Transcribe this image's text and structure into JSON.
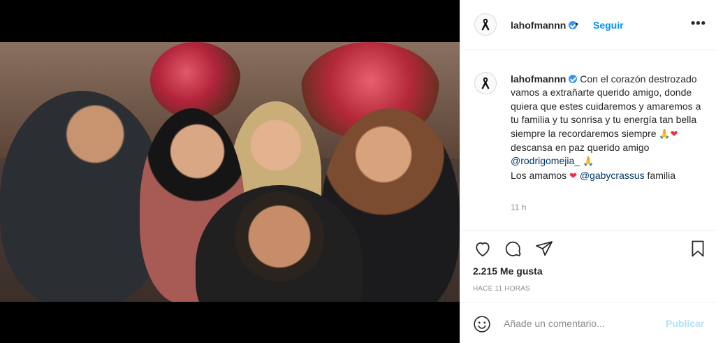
{
  "post": {
    "username": "lahofmannn",
    "follow_label": "Seguir",
    "separator": "•",
    "more_label": "•••"
  },
  "caption": {
    "username": "lahofmannn",
    "line1": "Con el corazón destrozado vamos a extrañarte querido amigo, donde quiera que estes cuidaremos y amaremos a tu familia y tu sonrisa y tu energía tan bella siempre la recordaremos siempre ",
    "emoji_pray": "🙏",
    "emoji_heart": "❤",
    "line2": "descansa en paz querido amigo ",
    "mention1": "@rodrigomejia_",
    "line3": "Los amamos ",
    "mention2": "@gabycrassus",
    "line4": " familia",
    "time": "11 h"
  },
  "actions": {
    "like_icon": "heart-outline-icon",
    "comment_icon": "comment-bubble-icon",
    "share_icon": "paper-plane-icon",
    "save_icon": "bookmark-icon"
  },
  "likes": "2.215 Me gusta",
  "posted_ago": "HACE 11 HORAS",
  "comment_box": {
    "placeholder": "Añade un comentario...",
    "publish_label": "Publicar"
  },
  "colors": {
    "link_blue": "#0095f6",
    "publish_disabled": "#b2dffc",
    "verified": "#3897f0",
    "muted": "#8e8e8e"
  }
}
